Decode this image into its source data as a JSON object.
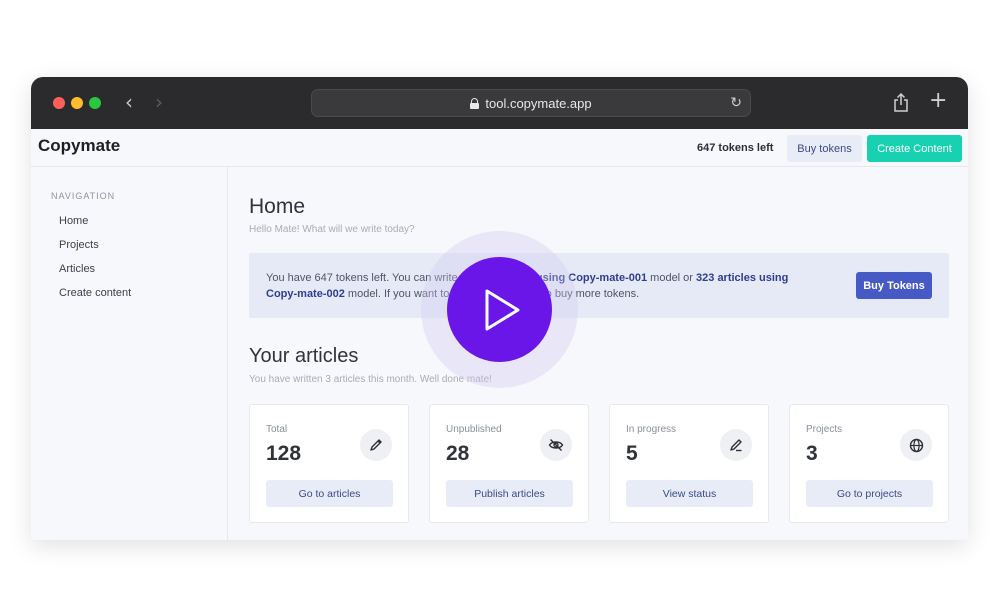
{
  "browser": {
    "url": "tool.copymate.app"
  },
  "header": {
    "brand": "Copymate",
    "tokens_left": "647 tokens left",
    "buy_tokens_label": "Buy tokens",
    "create_content_label": "Create Content"
  },
  "sidebar": {
    "heading": "NAVIGATION",
    "items": [
      {
        "label": "Home"
      },
      {
        "label": "Projects"
      },
      {
        "label": "Articles"
      },
      {
        "label": "Create content"
      }
    ]
  },
  "main": {
    "title": "Home",
    "subtitle": "Hello Mate! What will we write today?",
    "banner": {
      "text_1": "You have 647 tokens left. You can write at",
      "bold_1": "using Copy-mate-001",
      "text_2": " model or ",
      "bold_2": "323 articles using",
      "bold_3": "Copy-mate-002",
      "text_3": " model. If you want to",
      "text_4": "neber to buy more tokens.",
      "button_label": "Buy Tokens"
    },
    "articles_title": "Your articles",
    "articles_subtitle": "You have written 3 articles this month. Well done mate!",
    "cards": [
      {
        "label": "Total",
        "value": "128",
        "button": "Go to articles",
        "icon": "pencil-icon"
      },
      {
        "label": "Unpublished",
        "value": "28",
        "button": "Publish articles",
        "icon": "eye-off-icon"
      },
      {
        "label": "In progress",
        "value": "5",
        "button": "View status",
        "icon": "pen-icon"
      },
      {
        "label": "Projects",
        "value": "3",
        "button": "Go to projects",
        "icon": "globe-icon"
      }
    ]
  },
  "overlay": {
    "icon": "play-icon",
    "color": "#6a16e8"
  }
}
